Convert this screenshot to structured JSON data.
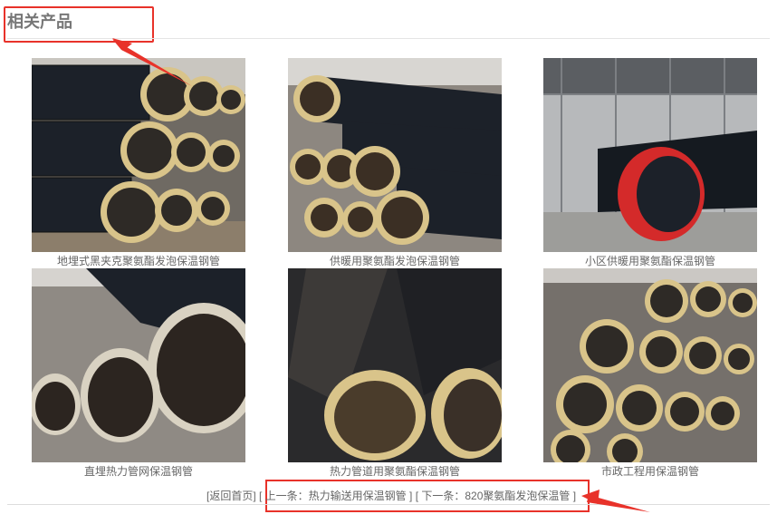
{
  "section": {
    "title": "相关产品"
  },
  "products": [
    {
      "caption": "地埋式黑夹克聚氨酯发泡保温钢管",
      "image_icon": "pipe-photo-icon"
    },
    {
      "caption": "供暖用聚氨酯发泡保温钢管",
      "image_icon": "pipe-photo-icon"
    },
    {
      "caption": "小区供暖用聚氨酯保温钢管",
      "image_icon": "pipe-photo-icon"
    },
    {
      "caption": "直埋热力管网保温钢管",
      "image_icon": "pipe-photo-icon"
    },
    {
      "caption": "热力管道用聚氨酯保温钢管",
      "image_icon": "pipe-photo-icon"
    },
    {
      "caption": "市政工程用保温钢管",
      "image_icon": "pipe-photo-icon"
    }
  ],
  "nav": {
    "back": "[返回首页]",
    "prev": "[ 上一条：热力输送用保温钢管 ]",
    "next": "[ 下一条：820聚氨酯发泡保温管 ]"
  },
  "colors": {
    "highlight": "#e8322a",
    "caption": "#666666",
    "pipe_black": "#1c2129",
    "foam": "#d9c48a"
  }
}
